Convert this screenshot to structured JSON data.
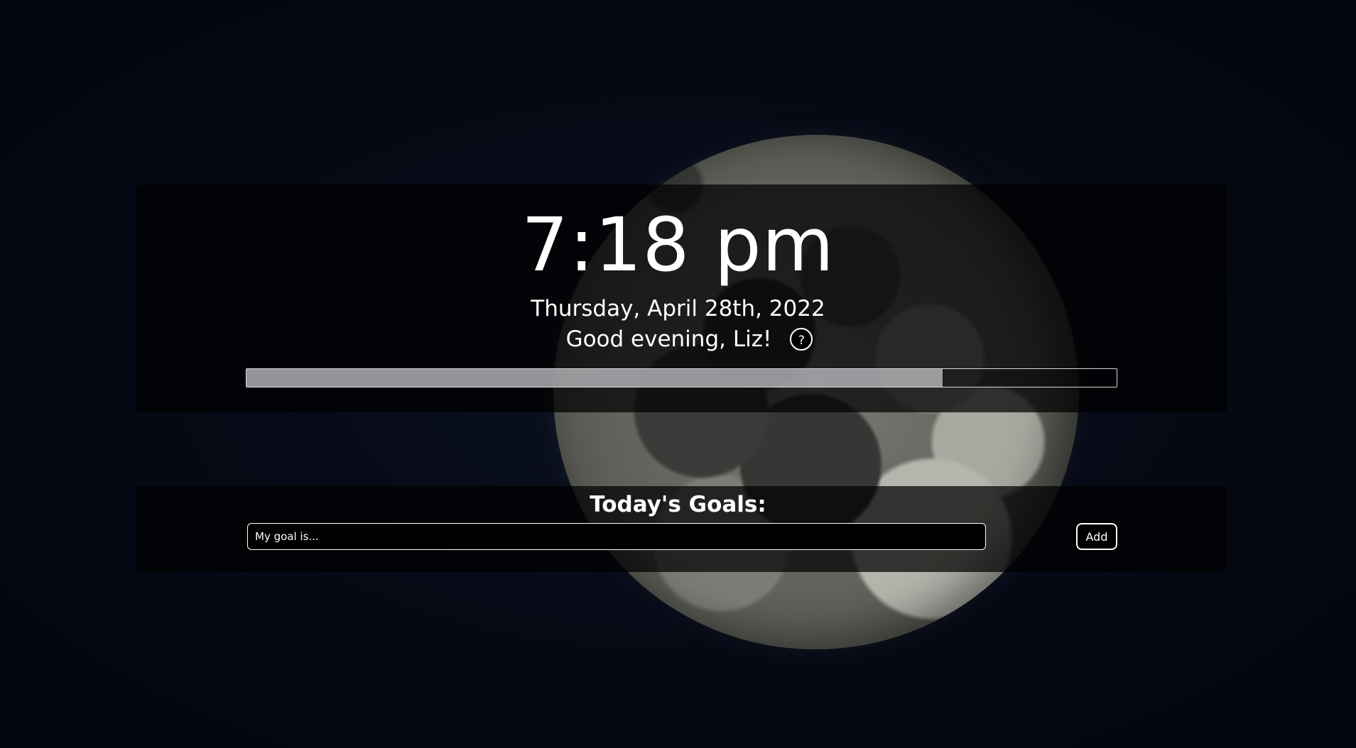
{
  "clock": {
    "time": "7:18 pm"
  },
  "date": {
    "text": "Thursday, April 28th, 2022"
  },
  "greeting": {
    "text": "Good evening,  Liz!",
    "help_label": "?"
  },
  "progress": {
    "fraction": 0.8
  },
  "goals": {
    "title": "Today's Goals:",
    "input_placeholder": "My goal is...",
    "add_label": "Add"
  },
  "background": {
    "image": "moon"
  }
}
